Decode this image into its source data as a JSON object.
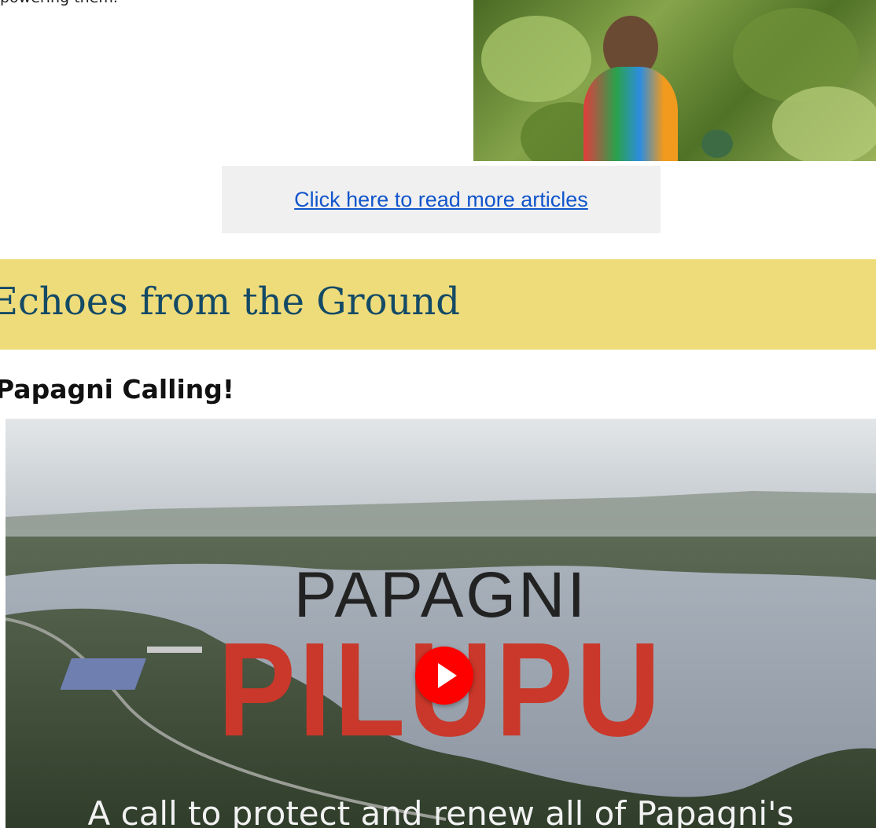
{
  "article": {
    "intro_tail": "powering them.",
    "photo_icon": "farmer-in-pumpkin-field-photo"
  },
  "cta": {
    "link_text": "Click here to read more articles"
  },
  "section": {
    "title": "Echoes from the Ground"
  },
  "video": {
    "title": "Papagni Calling!",
    "thumbnail_heading": "PAPAGNI",
    "thumbnail_brand": "PILUPU",
    "thumbnail_caption": "A call to protect and renew all of Papagni's",
    "play_icon": "play-icon",
    "play_color": "#ff0000"
  },
  "colors": {
    "link": "#1155cc",
    "band": "#eedb7a",
    "section_title": "#134a66",
    "brand_red": "#c9382a"
  }
}
